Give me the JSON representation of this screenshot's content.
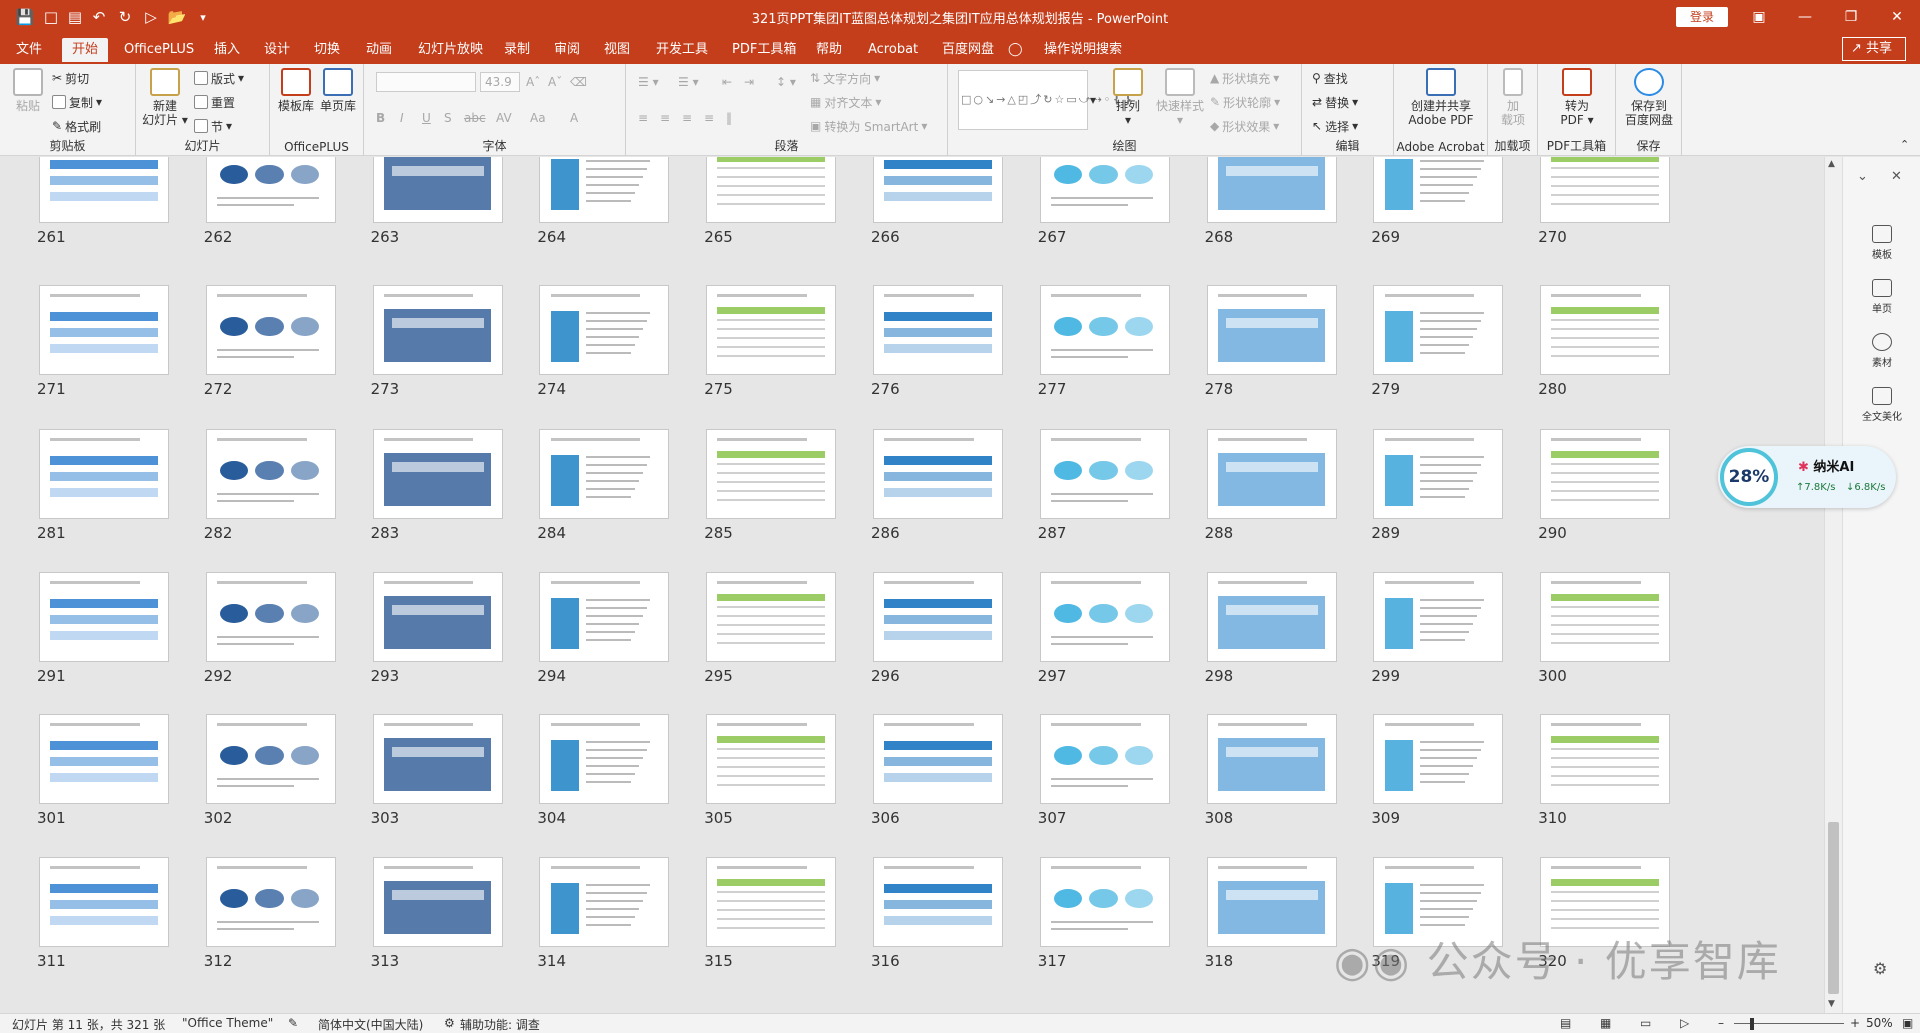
{
  "window": {
    "title": "321页PPT集团IT蓝图总体规划之集团IT应用总体规划报告 - PowerPoint",
    "login_label": "登录",
    "controls": [
      "ribbon-display-icon",
      "minimize-icon",
      "restore-icon",
      "close-icon"
    ]
  },
  "tabs": [
    {
      "label": "文件",
      "active": false
    },
    {
      "label": "开始",
      "active": true
    },
    {
      "label": "OfficePLUS",
      "active": false
    },
    {
      "label": "插入",
      "active": false
    },
    {
      "label": "设计",
      "active": false
    },
    {
      "label": "切换",
      "active": false
    },
    {
      "label": "动画",
      "active": false
    },
    {
      "label": "幻灯片放映",
      "active": false
    },
    {
      "label": "录制",
      "active": false
    },
    {
      "label": "审阅",
      "active": false
    },
    {
      "label": "视图",
      "active": false
    },
    {
      "label": "开发工具",
      "active": false
    },
    {
      "label": "PDF工具箱",
      "active": false
    },
    {
      "label": "帮助",
      "active": false
    },
    {
      "label": "Acrobat",
      "active": false
    },
    {
      "label": "百度网盘",
      "active": false
    },
    {
      "label": "操作说明搜索",
      "active": false
    }
  ],
  "share_label": "共享",
  "ribbon": {
    "clipboard": {
      "label": "剪贴板",
      "paste": "粘贴",
      "cut": "剪切",
      "copy": "复制",
      "format_painter": "格式刷"
    },
    "slides": {
      "label": "幻灯片",
      "new_slide_1": "新建",
      "new_slide_2": "幻灯片",
      "layout": "版式",
      "reset": "重置",
      "section": "节"
    },
    "officeplus": {
      "label": "OfficePLUS",
      "template": "模板库",
      "single_page": "单页库"
    },
    "font": {
      "label": "字体",
      "size": "43.9",
      "buttons": [
        "B",
        "I",
        "U",
        "S",
        "abc",
        "AV",
        "Aa",
        "A"
      ]
    },
    "paragraph": {
      "label": "段落",
      "text_direction": "文字方向",
      "align_text": "对齐文本",
      "smartart": "转换为 SmartArt"
    },
    "drawing": {
      "label": "绘图",
      "arrange": "排列",
      "quick_styles": "快速样式",
      "shape_fill": "形状填充",
      "shape_outline": "形状轮廓",
      "shape_effects": "形状效果"
    },
    "editing": {
      "label": "编辑",
      "find": "查找",
      "replace": "替换",
      "select": "选择"
    },
    "acrobat": {
      "label": "Adobe Acrobat",
      "create_1": "创建并共享",
      "create_2": "Adobe PDF"
    },
    "addins": {
      "label": "加载项",
      "btn_1": "加",
      "btn_2": "载项"
    },
    "pdftools": {
      "label": "PDF工具箱",
      "btn_1": "转为",
      "btn_2": "PDF"
    },
    "save": {
      "label": "保存",
      "btn_1": "保存到",
      "btn_2": "百度网盘"
    }
  },
  "slides": [
    {
      "n": "261"
    },
    {
      "n": "262"
    },
    {
      "n": "263"
    },
    {
      "n": "264"
    },
    {
      "n": "265"
    },
    {
      "n": "266"
    },
    {
      "n": "267"
    },
    {
      "n": "268"
    },
    {
      "n": "269"
    },
    {
      "n": "270"
    },
    {
      "n": "271"
    },
    {
      "n": "272"
    },
    {
      "n": "273"
    },
    {
      "n": "274"
    },
    {
      "n": "275"
    },
    {
      "n": "276"
    },
    {
      "n": "277"
    },
    {
      "n": "278"
    },
    {
      "n": "279"
    },
    {
      "n": "280"
    },
    {
      "n": "281"
    },
    {
      "n": "282"
    },
    {
      "n": "283"
    },
    {
      "n": "284"
    },
    {
      "n": "285"
    },
    {
      "n": "286"
    },
    {
      "n": "287"
    },
    {
      "n": "288"
    },
    {
      "n": "289"
    },
    {
      "n": "290"
    },
    {
      "n": "291"
    },
    {
      "n": "292"
    },
    {
      "n": "293"
    },
    {
      "n": "294"
    },
    {
      "n": "295"
    },
    {
      "n": "296"
    },
    {
      "n": "297"
    },
    {
      "n": "298"
    },
    {
      "n": "299"
    },
    {
      "n": "300"
    },
    {
      "n": "301"
    },
    {
      "n": "302"
    },
    {
      "n": "303"
    },
    {
      "n": "304"
    },
    {
      "n": "305"
    },
    {
      "n": "306"
    },
    {
      "n": "307"
    },
    {
      "n": "308"
    },
    {
      "n": "309"
    },
    {
      "n": "310"
    },
    {
      "n": "311"
    },
    {
      "n": "312"
    },
    {
      "n": "313"
    },
    {
      "n": "314"
    },
    {
      "n": "315"
    },
    {
      "n": "316"
    },
    {
      "n": "317"
    },
    {
      "n": "318"
    },
    {
      "n": "319"
    },
    {
      "n": "320"
    }
  ],
  "side_panel": [
    {
      "label": "模板",
      "icon": "template-icon"
    },
    {
      "label": "单页",
      "icon": "single-page-icon"
    },
    {
      "label": "素材",
      "icon": "material-icon"
    },
    {
      "label": "全文美化",
      "icon": "beautify-icon"
    }
  ],
  "ai_widget": {
    "percent": "28%",
    "name": "纳米AI",
    "up": "7.8K/s",
    "down": "6.8K/s"
  },
  "status": {
    "slide_info": "幻灯片 第 11 张，共 321 张",
    "theme": "\"Office Theme\"",
    "language": "简体中文(中国大陆)",
    "accessibility": "辅助功能: 调查",
    "zoom": "50%"
  },
  "watermark": "公众号 · 优享智库",
  "colors": {
    "accent": "#c43e1c",
    "ribbon_bg": "#f3f3f3",
    "sorter_bg": "#e6e6e6"
  }
}
